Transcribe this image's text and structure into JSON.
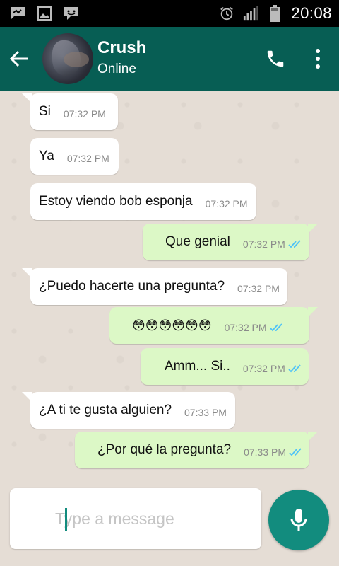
{
  "status_bar": {
    "time": "20:08",
    "left_icons": [
      "message-icon",
      "image-icon",
      "bbm-icon"
    ],
    "right_icons": [
      "alarm-icon",
      "signal-icon",
      "battery-icon"
    ]
  },
  "header": {
    "contact_name": "Crush",
    "contact_status": "Online",
    "icons": [
      "back-arrow-icon",
      "phone-icon",
      "more-vert-icon"
    ]
  },
  "messages": [
    {
      "direction": "in",
      "text": "Si",
      "time": "07:32 PM"
    },
    {
      "direction": "in",
      "text": "Ya",
      "time": "07:32 PM"
    },
    {
      "direction": "in",
      "text": "Estoy viendo bob esponja",
      "time": "07:32 PM"
    },
    {
      "direction": "out",
      "text": "Que genial",
      "time": "07:32 PM",
      "read": true
    },
    {
      "direction": "in",
      "text": "¿Puedo hacerte una pregunta?",
      "time": "07:32 PM"
    },
    {
      "direction": "out",
      "text": "😳😳😳😳😳😳",
      "time": "07:32 PM",
      "read": true
    },
    {
      "direction": "out",
      "text": "Amm... Si..",
      "time": "07:32 PM",
      "read": true
    },
    {
      "direction": "in",
      "text": "¿A ti te gusta alguien?",
      "time": "07:33 PM"
    },
    {
      "direction": "out",
      "text": "¿Por qué la pregunta?",
      "time": "07:33 PM",
      "read": true
    }
  ],
  "composer": {
    "placeholder": "Type a message",
    "value": ""
  },
  "colors": {
    "header": "#075e54",
    "accent": "#128c7e",
    "outgoing_bubble": "#dcf8c6",
    "incoming_bubble": "#ffffff",
    "read_ticks": "#4fc3f7"
  }
}
